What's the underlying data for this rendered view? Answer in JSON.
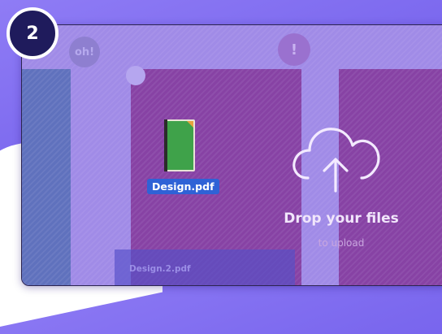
{
  "step": {
    "number": "2"
  },
  "badges": {
    "oh": "oh!",
    "bang": "!"
  },
  "file": {
    "name": "Design.pdf",
    "icon": "pdf-file-icon"
  },
  "drag_ghost": {
    "name": "Design.2.pdf"
  },
  "drop_zone": {
    "title": "Drop your files",
    "subtitle": "to upload",
    "icon": "cloud-upload-icon"
  },
  "colors": {
    "step_badge": "#1f1b5c",
    "file_label": "#2f62d6",
    "panel_purple": "#8a3d98",
    "left_column": "#5a77b6"
  }
}
